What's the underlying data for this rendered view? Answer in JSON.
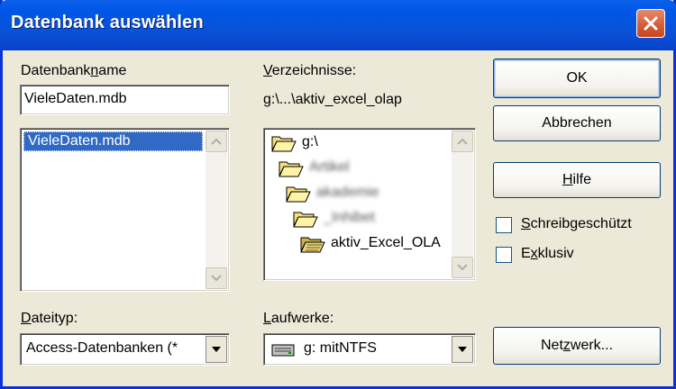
{
  "window": {
    "title": "Datenbank auswählen"
  },
  "labels": {
    "db_name_pre": "Datenbank",
    "db_name_ul": "n",
    "db_name_post": "ame",
    "dirs_ul": "V",
    "dirs_post": "erzeichnisse:",
    "current_dir": "g:\\...\\aktiv_excel_olap",
    "filetype_ul": "D",
    "filetype_post": "ateityp:",
    "drives_ul": "L",
    "drives_post": "aufwerke:"
  },
  "db_name_input": {
    "value": "VieleDaten.mdb"
  },
  "file_list": {
    "items": [
      "VieleDaten.mdb"
    ],
    "selected_index": 0
  },
  "folders": [
    {
      "label": "g:\\",
      "open": true
    },
    {
      "label": "Artikel",
      "open": true,
      "obscured": true
    },
    {
      "label": "akademie",
      "open": true,
      "obscured": true
    },
    {
      "label": "_Inhibet",
      "open": true,
      "obscured": true
    },
    {
      "label": "aktiv_Excel_OLA",
      "open": true,
      "current": true
    }
  ],
  "filetype_select": {
    "value": "Access-Datenbanken (*"
  },
  "drives_select": {
    "value": "g: mitNTFS"
  },
  "buttons": {
    "ok": "OK",
    "cancel": "Abbrechen",
    "help_ul": "H",
    "help_post": "ilfe",
    "network_pre": "Net",
    "network_ul": "z",
    "network_post": "werk..."
  },
  "checkboxes": {
    "readonly": {
      "ul": "S",
      "post": "chreibgeschützt",
      "checked": false
    },
    "exclusive": {
      "pre": "E",
      "ul": "x",
      "post": "klusiv",
      "checked": false
    }
  }
}
